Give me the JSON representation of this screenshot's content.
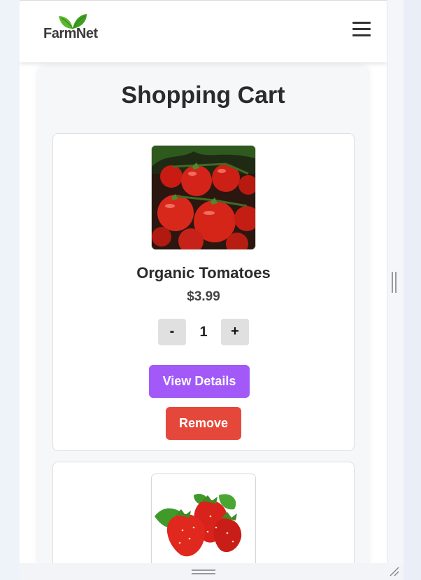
{
  "header": {
    "logo_text": "FarmNet",
    "menu_icon": "hamburger-menu-icon"
  },
  "page": {
    "title": "Shopping Cart"
  },
  "cart_items": [
    {
      "name": "Organic Tomatoes",
      "price": "$3.99",
      "quantity": "1",
      "decrement_label": "-",
      "increment_label": "+",
      "view_label": "View Details",
      "remove_label": "Remove",
      "image_icon": "tomatoes-image"
    },
    {
      "image_icon": "strawberries-image"
    }
  ],
  "colors": {
    "view_button": "#a259f7",
    "remove_button": "#e5483a",
    "logo_leaf": "#4caf2a"
  }
}
